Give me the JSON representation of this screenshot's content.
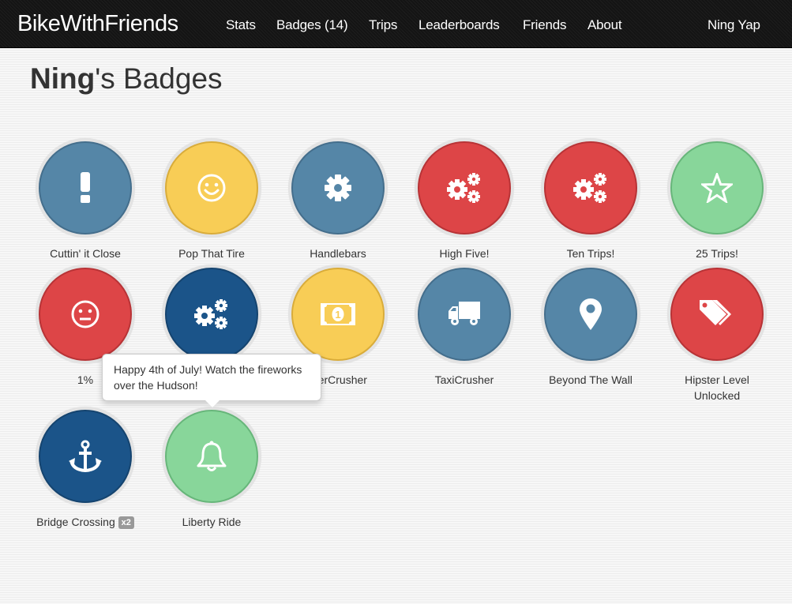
{
  "navbar": {
    "brand": "BikeWithFriends",
    "items": [
      {
        "label": "Stats"
      },
      {
        "label": "Badges (14)"
      },
      {
        "label": "Trips"
      },
      {
        "label": "Leaderboards"
      },
      {
        "label": "Friends"
      },
      {
        "label": "About"
      }
    ],
    "user": "Ning Yap"
  },
  "page": {
    "title_name": "Ning",
    "title_rest": "'s Badges"
  },
  "badges": [
    {
      "label": "Cuttin' it Close",
      "icon": "exclamation-icon",
      "color": "#5586a7"
    },
    {
      "label": "Pop That Tire",
      "icon": "smile-icon",
      "color": "#f8cd56"
    },
    {
      "label": "Handlebars",
      "icon": "gear-icon",
      "color": "#5586a7"
    },
    {
      "label": "High Five!",
      "icon": "gears-icon",
      "color": "#dd4547"
    },
    {
      "label": "Ten Trips!",
      "icon": "gears-icon",
      "color": "#dd4547"
    },
    {
      "label": "25 Trips!",
      "icon": "star-outline-icon",
      "color": "#88d69a"
    },
    {
      "label": "1%",
      "icon": "neutral-face-icon",
      "color": "#dd4547"
    },
    {
      "label": "",
      "icon": "gears-icon",
      "color": "#1b5489"
    },
    {
      "label": "...erCrusher",
      "icon": "money-bill-icon",
      "color": "#f8cd56"
    },
    {
      "label": "TaxiCrusher",
      "icon": "truck-icon",
      "color": "#5586a7"
    },
    {
      "label": "Beyond The Wall",
      "icon": "map-marker-icon",
      "color": "#5586a7"
    },
    {
      "label": "Hipster Level Unlocked",
      "icon": "tags-icon",
      "color": "#dd4547"
    },
    {
      "label": "Bridge Crossing",
      "icon": "anchor-icon",
      "color": "#1b5489",
      "count": "x2"
    },
    {
      "label": "Liberty Ride",
      "icon": "bell-icon",
      "color": "#88d69a"
    }
  ],
  "tooltip": {
    "text": "Happy 4th of July! Watch the fireworks over the Hudson!",
    "target": "Liberty Ride"
  }
}
